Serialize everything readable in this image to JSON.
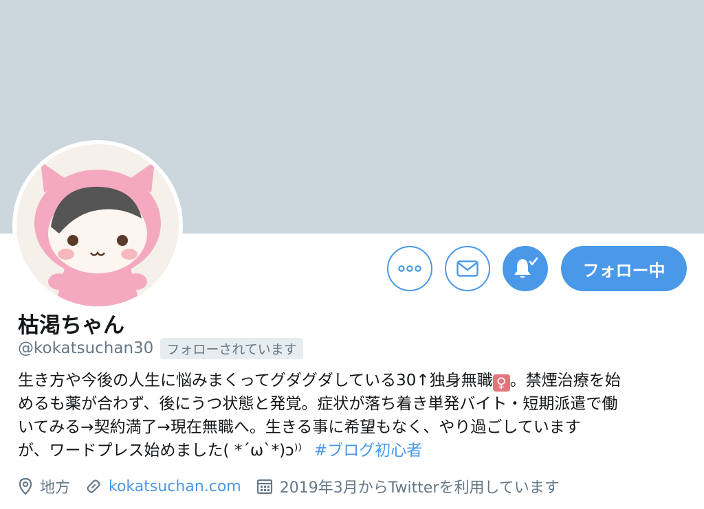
{
  "profile": {
    "name": "枯渇ちゃん",
    "handle": "@kokatsuchan30",
    "follows_you_label": "フォローされています",
    "bio_lines": [
      "生き方や今後の人生に悩みまくってグダグダしている30↑独身無職",
      "めるも薬が合わず、後にうつ状態と発覚。症状が落ち着き単発バイト・短期派遣で働",
      "いてみる→契約満了→現在無職へ。生きる事に希望もなく、やり過ごしています",
      "が、ワードプレス始めました( *´ω`*)ᴐ⁾⁾"
    ],
    "bio_emoji": "♀",
    "bio_line1_tail": "。禁煙治療を始",
    "hashtag": "#ブログ初心者",
    "location": "地方",
    "website": "kokatsuchan.com",
    "joined": "2019年3月からTwitterを利用しています"
  },
  "actions": {
    "more_icon": "more-icon",
    "message_icon": "mail-icon",
    "notify_icon": "bell-check-icon",
    "follow_label": "フォロー中"
  },
  "colors": {
    "accent": "#4a99e9",
    "banner": "#ccd6dd",
    "muted_text": "#657786"
  }
}
